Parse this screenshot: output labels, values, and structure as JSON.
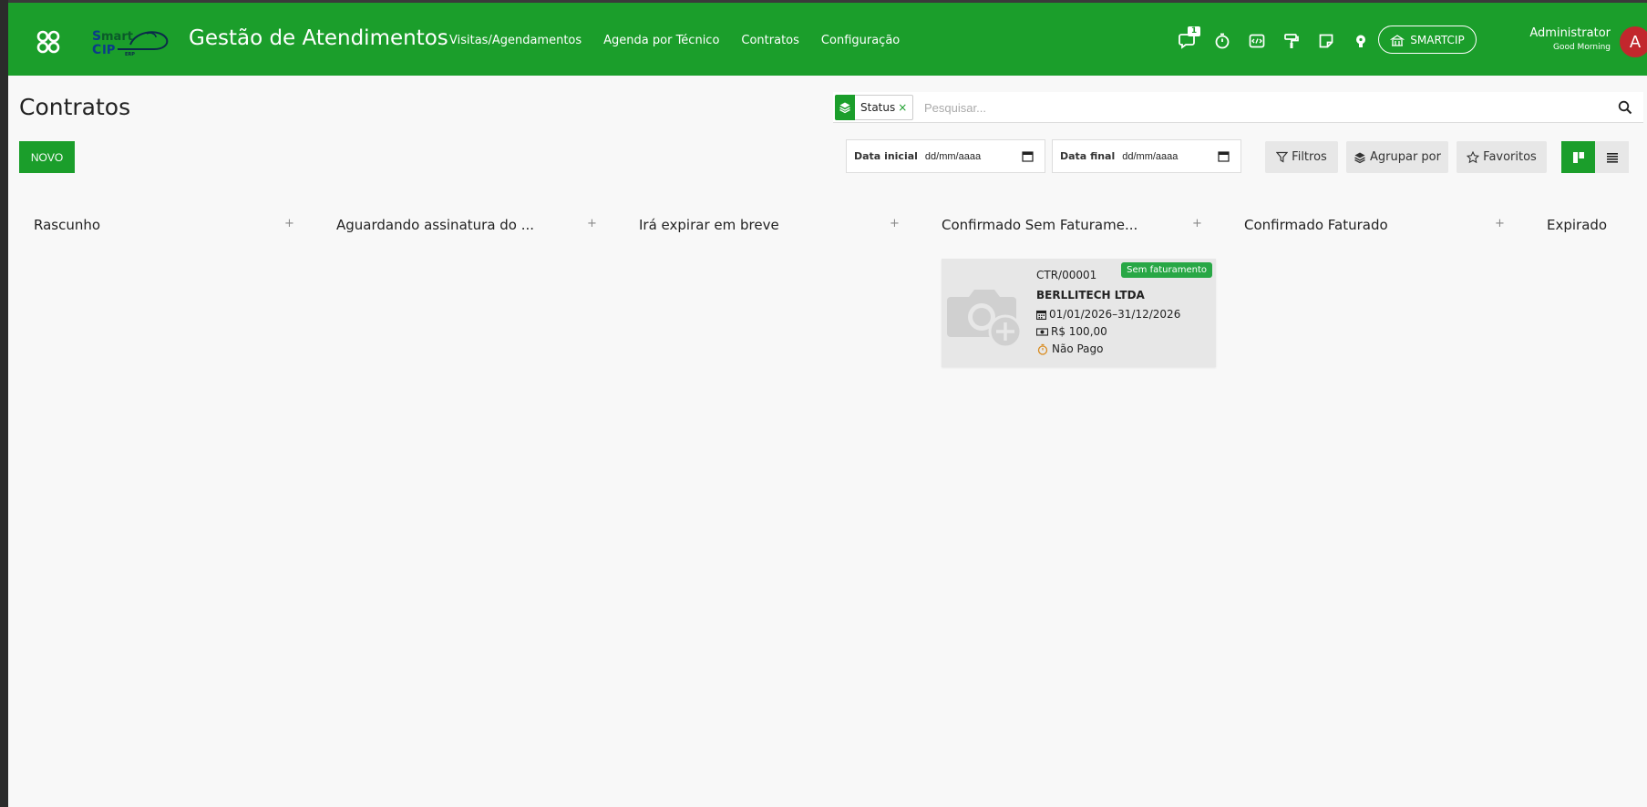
{
  "navbar": {
    "title": "Gestão de Atendimentos",
    "menu": [
      "Visitas/Agendamentos",
      "Agenda por Técnico",
      "Contratos",
      "Configuração"
    ],
    "message_count": "1",
    "company": "SMARTCIP",
    "user_name": "Administrator",
    "greeting": "Good Morning",
    "avatar_initial": "A",
    "logo_text": "Smart CIP",
    "logo_sub": "ERP",
    "accent_color": "#1b9e2b"
  },
  "control": {
    "page_title": "Contratos",
    "facet_label": "Status",
    "facet_remove": "×",
    "search_placeholder": "Pesquisar...",
    "new_label": "NOVO",
    "date_start_label": "Data inicial",
    "date_start_value": "dd/mm/aaaa",
    "date_end_label": "Data final",
    "date_end_value": "dd/mm/aaaa",
    "filters_label": "Filtros",
    "groupby_label": "Agrupar por",
    "favorites_label": "Favoritos"
  },
  "columns": [
    {
      "title": "Rascunho"
    },
    {
      "title": "Aguardando assinatura do ..."
    },
    {
      "title": "Irá expirar em breve"
    },
    {
      "title": "Confirmado Sem Faturame..."
    },
    {
      "title": "Confirmado Faturado"
    },
    {
      "title": "Expirado"
    }
  ],
  "card": {
    "ref": "CTR/00001",
    "badge": "Sem faturamento",
    "partner": "BERLLITECH LTDA",
    "dates": "01/01/2026–31/12/2026",
    "amount": "R$ 100,00",
    "payment": "Não Pago",
    "badge_color": "#28a745"
  }
}
